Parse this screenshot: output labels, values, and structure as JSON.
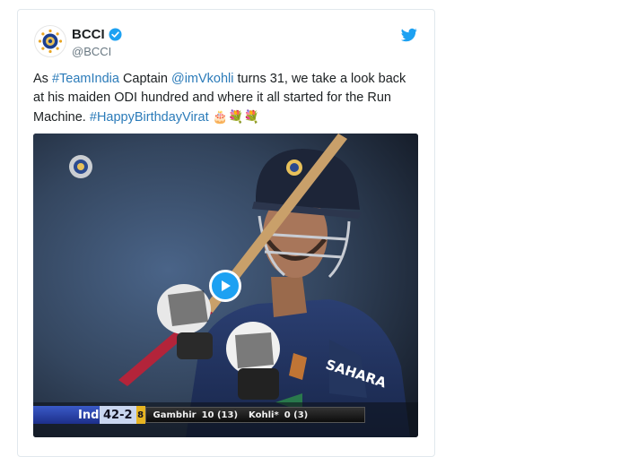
{
  "account": {
    "display_name": "BCCI",
    "handle": "@BCCI"
  },
  "tweet": {
    "seg1": "As ",
    "hashtag1": "#TeamIndia",
    "seg2": " Captain ",
    "mention": "@imVkohli",
    "seg3": " turns 31, we take a look back at his maiden ODI hundred and where it all started for the Run Machine. ",
    "hashtag2": "#HappyBirthdayVirat",
    "emojis": "🎂💐💐"
  },
  "video": {
    "scorebar": {
      "team": "Ind",
      "score": "42-2",
      "overs_marker": "8",
      "batter1": "Gambhir",
      "batter1_score": "10 (13)",
      "batter2": "Kohli*",
      "batter2_score": "0 (3)"
    }
  },
  "colors": {
    "link": "#2b7bb9",
    "twitter_blue": "#1da1f2",
    "text": "#1c2022",
    "muted": "#697882"
  },
  "icons": [
    "bcci-logo-icon",
    "verified-icon",
    "twitter-bird-icon",
    "play-icon"
  ]
}
